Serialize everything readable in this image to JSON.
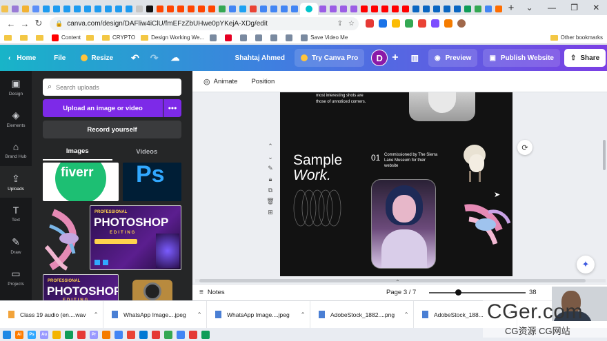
{
  "browser": {
    "tab_favicons": [
      "#f2c14e",
      "#9a7bd6",
      "#f2b233",
      "#5b8ff9",
      "#1d9bf0",
      "#1d9bf0",
      "#1d9bf0",
      "#1d9bf0",
      "#1d9bf0",
      "#1d9bf0",
      "#1d9bf0",
      "#1d9bf0",
      "#1d9bf0",
      "#c7c7c7",
      "#111111",
      "#ff4500",
      "#ff4500",
      "#ff4500",
      "#ff4500",
      "#ff4500",
      "#ff4500",
      "#34a853",
      "#4285f4",
      "#1da1f2",
      "#ea4335",
      "#4285f4",
      "#4285f4",
      "#4285f4",
      "#4285f4"
    ],
    "tab_favicons_right": [
      "#9b5de5",
      "#9b5de5",
      "#9b5de5",
      "#9b5de5",
      "#ff0000",
      "#ff0000",
      "#ff0000",
      "#ff0000",
      "#ff0000",
      "#0a66c2",
      "#0a66c2",
      "#0a66c2",
      "#0a66c2",
      "#0a66c2",
      "#0f9d58",
      "#34a853",
      "#4285f4",
      "#ff6d00"
    ],
    "new_tab_label": "+",
    "window_controls": [
      "⌄",
      "—",
      "❐",
      "✕"
    ],
    "back": "←",
    "forward": "→",
    "reload": "↻",
    "url": "canva.com/design/DAFliw4iClU/fmEFzZbUHwe0pYKejA-XDg/edit",
    "extensions": [
      "#e53935",
      "#1a73e8",
      "#fbbc04",
      "#34a853",
      "#ea4335",
      "#7c4dff",
      "#f57c00"
    ],
    "bookmarks": [
      {
        "label": "",
        "type": "folder"
      },
      {
        "label": "",
        "type": "folder"
      },
      {
        "label": "",
        "type": "folder"
      },
      {
        "label": "Content",
        "type": "youtube"
      },
      {
        "label": "",
        "type": "folder"
      },
      {
        "label": "CRYPTO",
        "type": "folder"
      },
      {
        "label": "Design Working We...",
        "type": "folder"
      },
      {
        "label": "",
        "type": "site"
      },
      {
        "label": "",
        "type": "pinterest"
      },
      {
        "label": "",
        "type": "site"
      },
      {
        "label": "",
        "type": "site"
      },
      {
        "label": "",
        "type": "site"
      },
      {
        "label": "",
        "type": "site"
      },
      {
        "label": "Save Video Me",
        "type": "site"
      }
    ],
    "other_bookmarks": "Other bookmarks"
  },
  "canva_top": {
    "home": "Home",
    "file": "File",
    "resize": "Resize",
    "user_name": "Shahtaj Ahmed",
    "try_pro": "Try Canva Pro",
    "avatar_letter": "D",
    "preview": "Preview",
    "publish": "Publish Website",
    "share": "Share"
  },
  "rail": [
    {
      "label": "Design",
      "icon": "▣"
    },
    {
      "label": "Elements",
      "icon": "◈"
    },
    {
      "label": "Brand Hub",
      "icon": "⌂"
    },
    {
      "label": "Uploads",
      "icon": "⇪"
    },
    {
      "label": "Text",
      "icon": "T"
    },
    {
      "label": "Draw",
      "icon": "✎"
    },
    {
      "label": "Projects",
      "icon": "▭"
    }
  ],
  "panel": {
    "search_placeholder": "Search uploads",
    "upload_label": "Upload an image or video",
    "upload_more": "•••",
    "record_label": "Record yourself",
    "tab_images": "Images",
    "tab_videos": "Videos",
    "thumb_fiverr": "fiverr",
    "thumb_ps": "Ps",
    "thumb_photoshop_pro": "PROFESSIONAL",
    "thumb_photoshop": "PHOTOSHOP",
    "thumb_editing": "EDITING"
  },
  "editor": {
    "animate": "Animate",
    "position": "Position",
    "canvas_top_text": "most interesting shots are those of unnoticed corners.",
    "sample": "Sample",
    "work": "Work.",
    "num": "01",
    "commissioned": "Commissioned by The Sierra Lane Museum for their website",
    "notes": "Notes",
    "page": "Page 3 / 7",
    "zoom_value": "38",
    "zoom_level": 0.3
  },
  "downloads": [
    {
      "name": "Class 19 audio (en....wav",
      "color": "#f2a33a"
    },
    {
      "name": "WhatsApp Image....jpeg",
      "color": "#4a7fd4"
    },
    {
      "name": "WhatsApp Image....jpeg",
      "color": "#4a7fd4"
    },
    {
      "name": "AdobeStock_1882....png",
      "color": "#4a7fd4"
    },
    {
      "name": "AdobeStock_188...",
      "color": "#4a7fd4"
    }
  ],
  "taskbar": [
    {
      "label": "",
      "color": "#1e88e5"
    },
    {
      "label": "Ai",
      "color": "#ff7c00"
    },
    {
      "label": "Ps",
      "color": "#31a8ff"
    },
    {
      "label": "Au",
      "color": "#9999ff"
    },
    {
      "label": "",
      "color": "#f4b400"
    },
    {
      "label": "",
      "color": "#0f9d58"
    },
    {
      "label": "",
      "color": "#e53935"
    },
    {
      "label": "Pr",
      "color": "#9999ff"
    },
    {
      "label": "",
      "color": "#f57c00"
    },
    {
      "label": "",
      "color": "#4285f4"
    },
    {
      "label": "",
      "color": "#ea4335"
    },
    {
      "label": "",
      "color": "#0078d4"
    },
    {
      "label": "",
      "color": "#e53935"
    },
    {
      "label": "",
      "color": "#34a853"
    },
    {
      "label": "",
      "color": "#4285f4"
    },
    {
      "label": "",
      "color": "#e53935"
    },
    {
      "label": "",
      "color": "#0f9d58"
    }
  ],
  "watermark": {
    "big": "CGer.com",
    "small": "CG资源 CG网站"
  }
}
